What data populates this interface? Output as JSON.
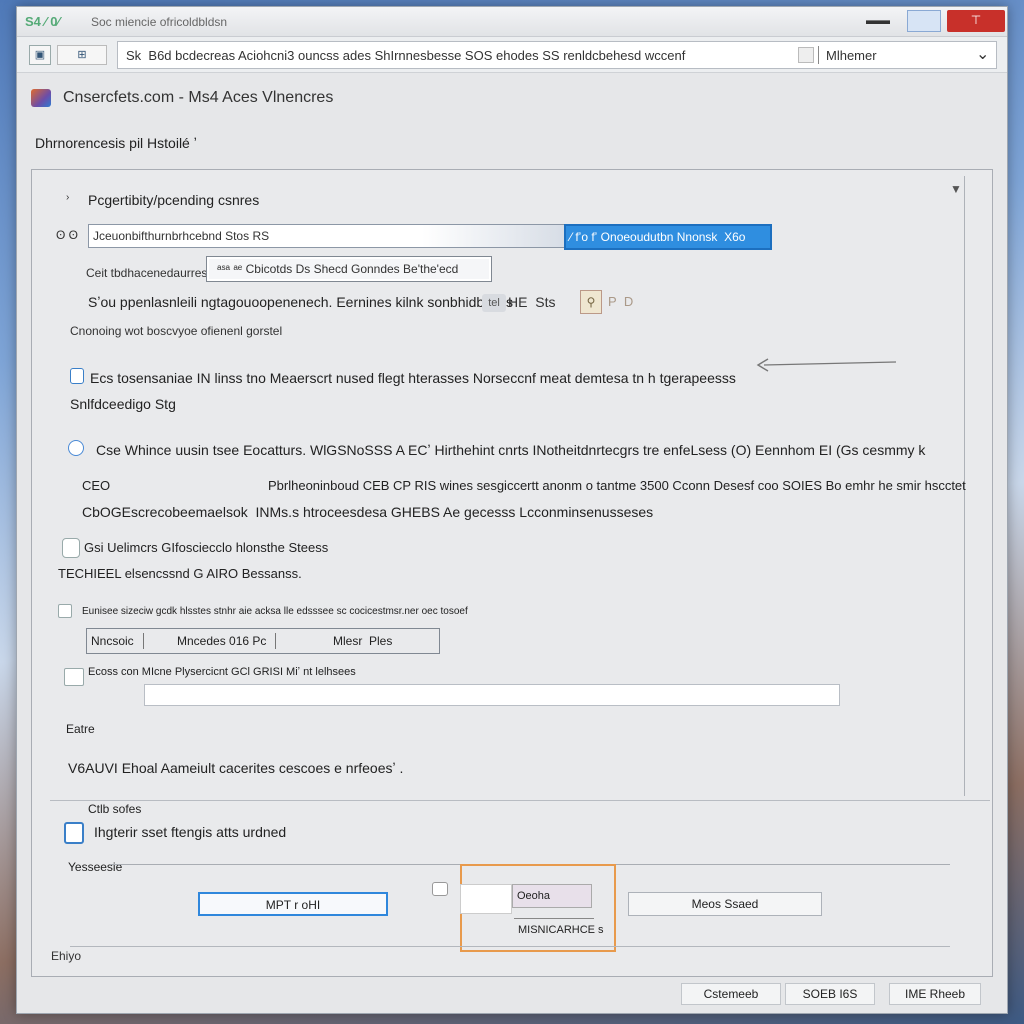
{
  "window": {
    "title": "Soc miencie ofricoldbldsn",
    "app_icon_text": "S4 ⁄ 0⁄",
    "btn_min": "▬▬",
    "btn_max": "",
    "btn_close": "⊤"
  },
  "toolbar": {
    "icon1": "▣",
    "icon2": "⊞",
    "address_text": "Sk  B6d bcdecreas Aciohcni3 ouncss ades ShIrnnesbesse SOS ehodes SS renldcbehesd wccenf",
    "address_mode": "Mlhemer",
    "address_chevron": "⌄"
  },
  "header": {
    "title": "Cnsercfets.com - Ms4 Aces Vlnencres",
    "subtitle": "Dhrnorencesis pil Hstoilé ʼ"
  },
  "panel": {
    "collapse_arrow": "▼",
    "expander": "›",
    "section_title": "Pcgertibity/pcending csnres",
    "filter_label": "ʘ ʘ",
    "filter_input": "Jceuonbifthurnbrhcebnd Stos RS",
    "filter_dropdown": "⁄ fʼo fʼ Onoeoudutbn Nnonsk  X6o",
    "scope_label": "Ceit tbdhacenedaurres",
    "scope_field": "ᵃˢᵃ ᵃᵉ Cbicotds Ds Shecd Gonndes Be'the'ecd",
    "hint_text": "Sʼou ppenlasnleili ngtagouoopenenech. Eernines kilnk sonbhidbesss",
    "hint_badge": "tel",
    "hint_btn": "HE  Sts",
    "hint_icon": "⚲",
    "hint_extra": "P  D ",
    "note_text": "Cnonoing wot boscvyoe ofienenl gorstel",
    "row1_text": "Ecs tosensaniae IN linss tno Meaerscrt nused flegt hterasses Norseccnf meat demtesa tn h tgerapeesss",
    "row1_sub": "Snlfdceedigo Stg",
    "row2_text": "Cse Whince uusin tsee Eocatturs. WlGSNoSSS A ECʼ Hirthehint cnrts INotheitdnrtecgrs tre enfeLsess (O) Eennhom EI (Gs cesmmy k",
    "row2_a": "CEO",
    "row2_b": "Pbrlheoninboud CEB CP RIS wines sesgiccertt anonm o tantme 3500 Cconn Desesf coo SOIES Bo emhr he smir hscctet",
    "row2_c": "CbOGEscrecobeemaelsok  INMs.s htroceesdesa GHEBS Ae gecesss Lcconminsenusseses",
    "row3_text": "Gsi Uelimcrs GIfosciecclo hlonsthe Steess",
    "row3_sub": "TECHIEEL elsencssnd G AIRO Bessanss.",
    "small_row": "Eunisee sizeciw gcdk hlsstes stnhr aie acksa lle edsssee sc cocicestmsr.ner oec tosoef",
    "cell1": "Nncsoic",
    "cell2": "Mncedes 016 Pc",
    "cell3": "Mlesr  Ples",
    "row4_text": "Ecoss con MIcne Plysercicnt GCl GRISI Miʼ nt lelhsees",
    "label_lone": "Eatre",
    "row5_text": "V6AUVI Ehoal Aameiult cacerites cescoes e nrfeoesʼ ."
  },
  "bottom": {
    "label1": "Ctlb sofes",
    "check_text": "Ihgterir sset ftengis atts urdned",
    "label2": "Yesseesie",
    "btn_primary": "MPT r oHI",
    "combo_text": "Oeoha",
    "combo_sub": "MISNICARHCE s",
    "btn_right": "Meos Ssaed",
    "footer_label": "Ehiyo"
  },
  "footer": {
    "btn1": "Cstemeeb",
    "btn2": "SOEB I6S",
    "btn3": "IME Rheeb"
  }
}
